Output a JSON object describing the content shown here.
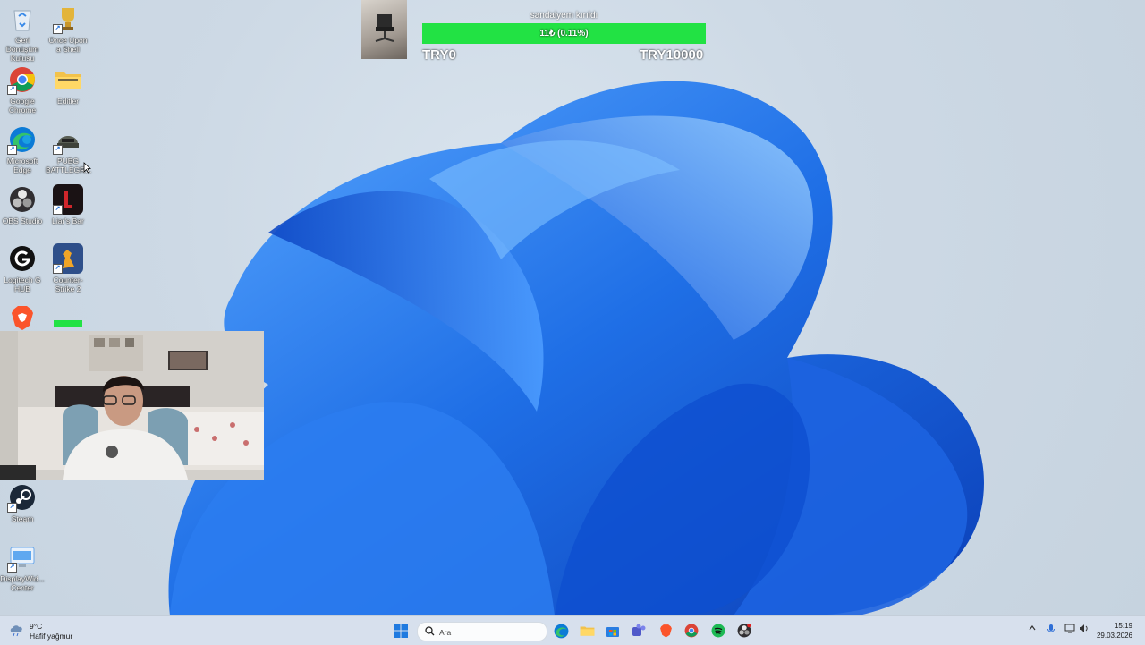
{
  "desktop_icons": [
    {
      "label": "Geri Dönüşüm Kutusu",
      "icon": "recycle-bin-icon"
    },
    {
      "label": "Once Upon a Shell",
      "icon": "trophy-icon"
    },
    {
      "label": "Google Chrome",
      "icon": "chrome-icon"
    },
    {
      "label": "Editler",
      "icon": "folder-icon"
    },
    {
      "label": "Microsoft Edge",
      "icon": "edge-icon"
    },
    {
      "label": "PUBG BATTLEGR...",
      "icon": "pubg-helmet-icon"
    },
    {
      "label": "OBS Studio",
      "icon": "obs-icon"
    },
    {
      "label": "Liar's Bar",
      "icon": "liars-bar-icon"
    },
    {
      "label": "Logitech G HUB",
      "icon": "logitech-g-icon"
    },
    {
      "label": "Counter-Strike 2",
      "icon": "counter-strike-icon"
    },
    {
      "label": "",
      "icon": "brave-icon"
    },
    {
      "label": "Steam",
      "icon": "steam-icon"
    },
    {
      "label": "DisplayWid... Center",
      "icon": "display-widget-icon"
    }
  ],
  "donation_goal": {
    "title": "sandalyem kırıldı",
    "progress_text": "11₺ (0.11%)",
    "progress_fraction": 0.0011,
    "min_label": "TRY0",
    "max_label": "TRY10000",
    "bar_color": "#22e244"
  },
  "taskbar": {
    "weather_temp": "9°C",
    "weather_desc": "Hafif yağmur",
    "search_placeholder": "Ara",
    "apps": [
      "start-icon",
      "search-icon",
      "edge-icon",
      "file-explorer-icon",
      "store-icon",
      "teams-icon",
      "brave-icon",
      "chrome-icon",
      "spotify-icon",
      "obs-icon"
    ],
    "time": "15:19",
    "date": "29.03.2026"
  },
  "colors": {
    "wallpaper_blue": "#1f6fe6",
    "taskbar_bg": "#d6e0ec",
    "accent": "#22e244"
  }
}
